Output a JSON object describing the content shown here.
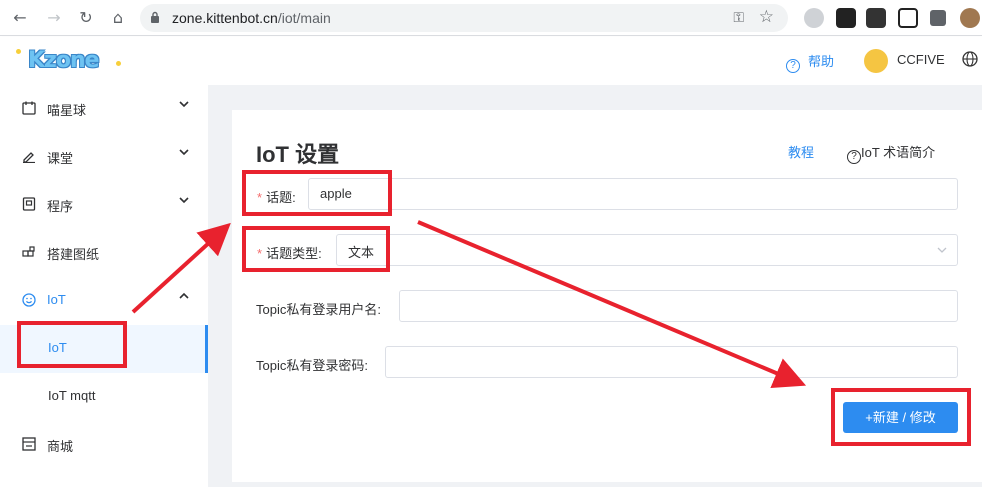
{
  "browser": {
    "url_host": "zone.kittenbot.cn",
    "url_path": "/iot/main"
  },
  "header": {
    "logo_text": "Kzone",
    "help_label": "帮助",
    "username": "CCFIVE"
  },
  "sidebar": {
    "items": [
      {
        "label": "喵星球",
        "icon": "calendar-icon"
      },
      {
        "label": "课堂",
        "icon": "pen-icon"
      },
      {
        "label": "程序",
        "icon": "document-icon"
      },
      {
        "label": "搭建图纸",
        "icon": "blocks-icon"
      },
      {
        "label": "IoT",
        "icon": "smile-icon"
      },
      {
        "label": "商城",
        "icon": "store-icon"
      }
    ],
    "sub_items": [
      {
        "label": "IoT"
      },
      {
        "label": "IoT mqtt"
      }
    ]
  },
  "main": {
    "title": "IoT 设置",
    "tutorial_link": "教程",
    "glossary_link": "IoT 术语简介",
    "glossary_glyph": "?",
    "form": {
      "topic_label": "话题:",
      "topic_value": "apple",
      "topic_type_label": "话题类型:",
      "topic_type_value": "文本",
      "username_label": "Topic私有登录用户名:",
      "username_value": "",
      "password_label": "Topic私有登录密码:",
      "password_value": "",
      "required_mark": "*"
    },
    "submit_label": "+新建 / 修改"
  },
  "colors": {
    "accent": "#2d8cf0",
    "annotation_red": "#e8222e",
    "required_red": "#f56c6c"
  }
}
